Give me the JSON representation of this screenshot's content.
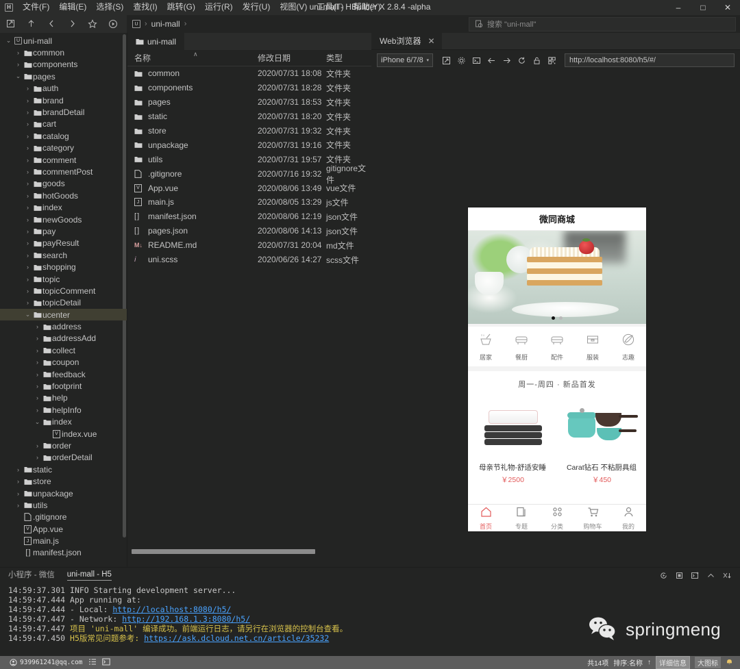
{
  "titlebar": {
    "logo": "H",
    "menus": [
      "文件(F)",
      "编辑(E)",
      "选择(S)",
      "查找(I)",
      "跳转(G)",
      "运行(R)",
      "发行(U)",
      "视图(V)",
      "工具(T)",
      "帮助(Y)"
    ],
    "window_title": "uni-mall - HBuilder X 2.8.4 -alpha",
    "minimize": "–",
    "maximize": "□",
    "close": "✕"
  },
  "toolrow": {
    "buttons": [
      "open-folder-icon",
      "up-icon",
      "back-icon",
      "forward-icon",
      "star-icon",
      "run-icon"
    ],
    "breadcrumb": {
      "root": "uni-mall",
      "sep": "›"
    },
    "search_placeholder": "搜索 \"uni-mall\""
  },
  "tree": {
    "items": [
      {
        "label": "uni-mall",
        "depth": 0,
        "type": "project",
        "state": "open",
        "selected": false
      },
      {
        "label": "common",
        "depth": 1,
        "type": "folder",
        "state": "closed",
        "selected": false
      },
      {
        "label": "components",
        "depth": 1,
        "type": "folder",
        "state": "closed",
        "selected": false
      },
      {
        "label": "pages",
        "depth": 1,
        "type": "folder",
        "state": "open",
        "selected": false
      },
      {
        "label": "auth",
        "depth": 2,
        "type": "folder",
        "state": "closed",
        "selected": false
      },
      {
        "label": "brand",
        "depth": 2,
        "type": "folder",
        "state": "closed",
        "selected": false
      },
      {
        "label": "brandDetail",
        "depth": 2,
        "type": "folder",
        "state": "closed",
        "selected": false
      },
      {
        "label": "cart",
        "depth": 2,
        "type": "folder",
        "state": "closed",
        "selected": false
      },
      {
        "label": "catalog",
        "depth": 2,
        "type": "folder",
        "state": "closed",
        "selected": false
      },
      {
        "label": "category",
        "depth": 2,
        "type": "folder",
        "state": "closed",
        "selected": false
      },
      {
        "label": "comment",
        "depth": 2,
        "type": "folder",
        "state": "closed",
        "selected": false
      },
      {
        "label": "commentPost",
        "depth": 2,
        "type": "folder",
        "state": "closed",
        "selected": false
      },
      {
        "label": "goods",
        "depth": 2,
        "type": "folder",
        "state": "closed",
        "selected": false
      },
      {
        "label": "hotGoods",
        "depth": 2,
        "type": "folder",
        "state": "closed",
        "selected": false
      },
      {
        "label": "index",
        "depth": 2,
        "type": "folder",
        "state": "closed",
        "selected": false
      },
      {
        "label": "newGoods",
        "depth": 2,
        "type": "folder",
        "state": "closed",
        "selected": false
      },
      {
        "label": "pay",
        "depth": 2,
        "type": "folder",
        "state": "closed",
        "selected": false
      },
      {
        "label": "payResult",
        "depth": 2,
        "type": "folder",
        "state": "closed",
        "selected": false
      },
      {
        "label": "search",
        "depth": 2,
        "type": "folder",
        "state": "closed",
        "selected": false
      },
      {
        "label": "shopping",
        "depth": 2,
        "type": "folder",
        "state": "closed",
        "selected": false
      },
      {
        "label": "topic",
        "depth": 2,
        "type": "folder",
        "state": "closed",
        "selected": false
      },
      {
        "label": "topicComment",
        "depth": 2,
        "type": "folder",
        "state": "closed",
        "selected": false
      },
      {
        "label": "topicDetail",
        "depth": 2,
        "type": "folder",
        "state": "closed",
        "selected": false
      },
      {
        "label": "ucenter",
        "depth": 2,
        "type": "folder",
        "state": "open",
        "selected": true
      },
      {
        "label": "address",
        "depth": 3,
        "type": "folder",
        "state": "closed",
        "selected": false
      },
      {
        "label": "addressAdd",
        "depth": 3,
        "type": "folder",
        "state": "closed",
        "selected": false
      },
      {
        "label": "collect",
        "depth": 3,
        "type": "folder",
        "state": "closed",
        "selected": false
      },
      {
        "label": "coupon",
        "depth": 3,
        "type": "folder",
        "state": "closed",
        "selected": false
      },
      {
        "label": "feedback",
        "depth": 3,
        "type": "folder",
        "state": "closed",
        "selected": false
      },
      {
        "label": "footprint",
        "depth": 3,
        "type": "folder",
        "state": "closed",
        "selected": false
      },
      {
        "label": "help",
        "depth": 3,
        "type": "folder",
        "state": "closed",
        "selected": false
      },
      {
        "label": "helpInfo",
        "depth": 3,
        "type": "folder",
        "state": "closed",
        "selected": false
      },
      {
        "label": "index",
        "depth": 3,
        "type": "folder",
        "state": "open",
        "selected": false
      },
      {
        "label": "index.vue",
        "depth": 4,
        "type": "vue",
        "state": "none",
        "selected": false
      },
      {
        "label": "order",
        "depth": 3,
        "type": "folder",
        "state": "closed",
        "selected": false
      },
      {
        "label": "orderDetail",
        "depth": 3,
        "type": "folder",
        "state": "closed",
        "selected": false
      },
      {
        "label": "static",
        "depth": 1,
        "type": "folder",
        "state": "closed",
        "selected": false
      },
      {
        "label": "store",
        "depth": 1,
        "type": "folder",
        "state": "closed",
        "selected": false
      },
      {
        "label": "unpackage",
        "depth": 1,
        "type": "folder",
        "state": "closed",
        "selected": false
      },
      {
        "label": "utils",
        "depth": 1,
        "type": "folder",
        "state": "closed",
        "selected": false
      },
      {
        "label": ".gitignore",
        "depth": 1,
        "type": "file",
        "state": "none",
        "selected": false
      },
      {
        "label": "App.vue",
        "depth": 1,
        "type": "vue",
        "state": "none",
        "selected": false
      },
      {
        "label": "main.js",
        "depth": 1,
        "type": "js",
        "state": "none",
        "selected": false
      },
      {
        "label": "manifest.json",
        "depth": 1,
        "type": "json",
        "state": "none",
        "selected": false
      }
    ]
  },
  "filepane": {
    "tab_label": "uni-mall",
    "columns": [
      "名称",
      "修改日期",
      "类型"
    ],
    "sort_indicator": "∧",
    "rows": [
      {
        "name": "common",
        "icon": "folder",
        "date": "2020/07/31 18:08",
        "type": "文件夹"
      },
      {
        "name": "components",
        "icon": "folder",
        "date": "2020/07/31 18:28",
        "type": "文件夹"
      },
      {
        "name": "pages",
        "icon": "folder",
        "date": "2020/07/31 18:53",
        "type": "文件夹"
      },
      {
        "name": "static",
        "icon": "folder",
        "date": "2020/07/31 18:20",
        "type": "文件夹"
      },
      {
        "name": "store",
        "icon": "folder",
        "date": "2020/07/31 19:32",
        "type": "文件夹"
      },
      {
        "name": "unpackage",
        "icon": "folder",
        "date": "2020/07/31 19:16",
        "type": "文件夹"
      },
      {
        "name": "utils",
        "icon": "folder",
        "date": "2020/07/31 19:57",
        "type": "文件夹"
      },
      {
        "name": ".gitignore",
        "icon": "file",
        "date": "2020/07/16 19:32",
        "type": "gitignore文件"
      },
      {
        "name": "App.vue",
        "icon": "vue",
        "date": "2020/08/06 13:49",
        "type": "vue文件"
      },
      {
        "name": "main.js",
        "icon": "js",
        "date": "2020/08/05 13:29",
        "type": "js文件"
      },
      {
        "name": "manifest.json",
        "icon": "json",
        "date": "2020/08/06 12:19",
        "type": "json文件"
      },
      {
        "name": "pages.json",
        "icon": "json",
        "date": "2020/08/06 14:13",
        "type": "json文件"
      },
      {
        "name": "README.md",
        "icon": "md",
        "date": "2020/07/31 20:04",
        "type": "md文件"
      },
      {
        "name": "uni.scss",
        "icon": "scss",
        "date": "2020/06/26 14:27",
        "type": "scss文件"
      }
    ]
  },
  "browser": {
    "tab_label": "Web浏览器",
    "tab_close": "✕",
    "device": "iPhone 6/7/8",
    "device_caret": "▾",
    "toolbar_icons": [
      "open-external-icon",
      "settings-icon",
      "console-icon",
      "back-icon",
      "forward-icon",
      "reload-icon",
      "lock-icon",
      "qr-code-icon"
    ],
    "url": "http://localhost:8080/h5/#/"
  },
  "phone": {
    "nav_title": "微同商城",
    "banner_dots": 2,
    "banner_active": 0,
    "categories": [
      {
        "label": "居家",
        "icon": "mortar-icon"
      },
      {
        "label": "餐厨",
        "icon": "sofa-icon"
      },
      {
        "label": "配件",
        "icon": "sofa-icon"
      },
      {
        "label": "服装",
        "icon": "box-icon"
      },
      {
        "label": "志趣",
        "icon": "brush-icon"
      }
    ],
    "section_title": "周一-周四 · 新品首发",
    "goods": [
      {
        "name": "母亲节礼物-舒适安睡",
        "price": "￥2500",
        "image": "pillow-stack"
      },
      {
        "name": "Carat钻石 不粘厨具组",
        "price": "￥450",
        "image": "cookware-set"
      }
    ],
    "tabbar": [
      {
        "label": "首页",
        "icon": "home-icon",
        "active": true
      },
      {
        "label": "专题",
        "icon": "pages-icon",
        "active": false
      },
      {
        "label": "分类",
        "icon": "grid-icon",
        "active": false
      },
      {
        "label": "购物车",
        "icon": "cart-icon",
        "active": false
      },
      {
        "label": "我的",
        "icon": "user-icon",
        "active": false
      }
    ]
  },
  "console": {
    "tabs": [
      {
        "label": "小程序 - 微信",
        "active": false
      },
      {
        "label": "uni-mall - H5",
        "active": true
      }
    ],
    "icons": [
      "rerun-icon",
      "stop-icon",
      "new-terminal-icon",
      "collapse-icon",
      "clear-icon"
    ],
    "lines": [
      {
        "ts": "14:59:37.301",
        "parts": [
          {
            "t": "  INFO  Starting development server...",
            "c": "kw"
          }
        ]
      },
      {
        "ts": "14:59:47.444",
        "parts": [
          {
            "t": "   App running at:",
            "c": "kw"
          }
        ]
      },
      {
        "ts": "14:59:47.444",
        "parts": [
          {
            "t": "   - Local:   ",
            "c": "kw"
          },
          {
            "t": "http://localhost:8080/h5/",
            "c": "lnk"
          }
        ]
      },
      {
        "ts": "14:59:47.447",
        "parts": [
          {
            "t": "   - Network: ",
            "c": "kw"
          },
          {
            "t": "http://192.168.1.3:8080/h5/",
            "c": "lnk"
          }
        ]
      },
      {
        "ts": "14:59:47.447",
        "parts": [
          {
            "t": " 项目 'uni-mall' 编译成功。前端运行日志，请另行在浏览器的控制台查看。",
            "c": "ok"
          }
        ]
      },
      {
        "ts": "14:59:47.450",
        "parts": [
          {
            "t": " H5版常见问题参考: ",
            "c": "ok"
          },
          {
            "t": "https://ask.dcloud.net.cn/article/35232",
            "c": "lnk"
          }
        ]
      }
    ],
    "watermark": "springmeng"
  },
  "status": {
    "user": "939961241@qq.com",
    "left_icons": [
      "list-icon",
      "terminal-icon"
    ],
    "count": "共14项",
    "sort": "排序:名称",
    "sort_arrow": "↑",
    "view_detail": "详细信息",
    "view_large": "大图标",
    "bell": "bell-icon"
  }
}
